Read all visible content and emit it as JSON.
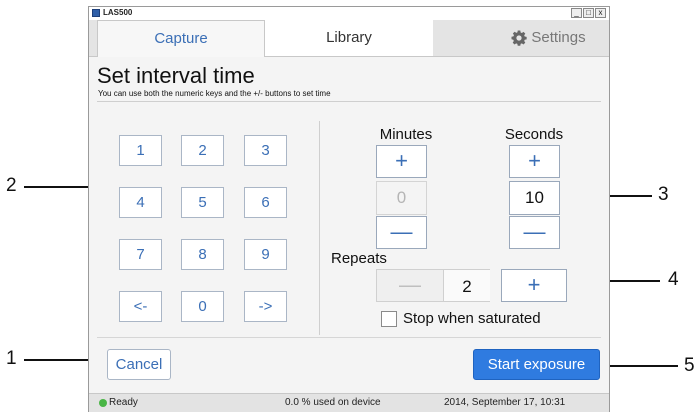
{
  "window": {
    "title": "LAS500",
    "controls": [
      "_",
      "□",
      "x"
    ]
  },
  "tabs": [
    {
      "label": "Capture",
      "active": true
    },
    {
      "label": "Library",
      "active": false
    },
    {
      "label": "Settings",
      "icon": "gear-icon",
      "active": false
    }
  ],
  "heading": "Set interval time",
  "subheading": "You can use both the numeric keys and the +/- buttons to set time",
  "keypad": {
    "keys": [
      "1",
      "2",
      "3",
      "4",
      "5",
      "6",
      "7",
      "8",
      "9",
      "<-",
      "0",
      "->"
    ]
  },
  "minutes": {
    "label": "Minutes",
    "plus": "+",
    "value": "0",
    "minus": "—",
    "enabled": false
  },
  "seconds": {
    "label": "Seconds",
    "plus": "+",
    "value": "10",
    "minus": "—",
    "enabled": true
  },
  "repeats": {
    "label": "Repeats",
    "minus": "—",
    "value": "2",
    "plus": "+"
  },
  "stop_when_saturated": {
    "label": "Stop when saturated",
    "checked": false
  },
  "buttons": {
    "cancel": "Cancel",
    "start": "Start exposure"
  },
  "status": {
    "state": "Ready",
    "used": "0.0 % used on device",
    "datetime": "2014, September 17, 10:31"
  },
  "callouts": [
    "1",
    "2",
    "3",
    "4",
    "5"
  ],
  "colors": {
    "accent": "#3b6fb6",
    "primary_button": "#2f7be0",
    "status_ok": "#49b545"
  }
}
